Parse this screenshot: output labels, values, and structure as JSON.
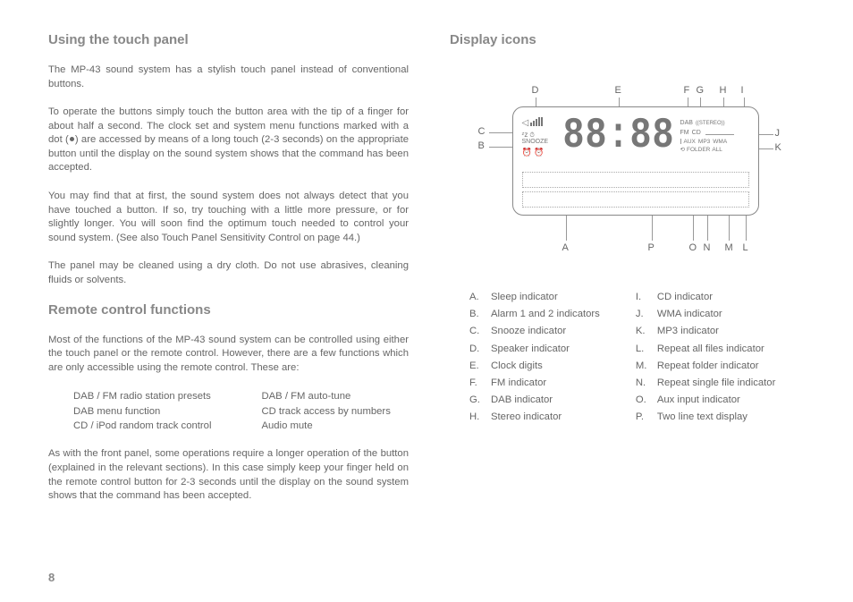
{
  "left": {
    "h1": "Using the touch panel",
    "p1": "The MP-43 sound system has a stylish touch panel instead of conventional buttons.",
    "p2a": "To operate the buttons simply touch the button area with the tip of a finger for about half a second. The clock set and system menu functions marked with a dot (",
    "p2b": ") are accessed by means of a long touch (2-3 seconds) on the appropriate button until the display on the sound system shows that the command has been accepted.",
    "p3": "You may find that at first, the sound system does not always detect that you have touched a button. If so, try touching with a little more pressure, or for slightly longer. You will soon find the optimum touch needed to control your sound system. (See also Touch Panel Sensitivity Control on page 44.)",
    "p4": "The panel may be cleaned using a dry cloth. Do not use abrasives, cleaning fluids or solvents.",
    "h2": "Remote control functions",
    "p5": "Most of the functions of the MP-43 sound system can be controlled using either the touch panel or the remote control. However, there are a few functions which are only accessible using the remote control. These are:",
    "func_l1": "DAB / FM radio station presets",
    "func_l2": "DAB menu function",
    "func_l3": "CD / iPod random track control",
    "func_r1": "DAB / FM auto-tune",
    "func_r2": "CD track access by numbers",
    "func_r3": "Audio mute",
    "p6": "As with the front panel, some operations require a longer operation of the button (explained in the relevant sections). In this case simply keep your finger held on the remote control button for 2-3 seconds until the display on the sound system shows that the command has been accepted."
  },
  "right": {
    "h1": "Display icons",
    "labels": {
      "A": "A",
      "B": "B",
      "C": "C",
      "D": "D",
      "E": "E",
      "F": "F",
      "G": "G",
      "H": "H",
      "I": "I",
      "J": "J",
      "K": "K",
      "L": "L",
      "M": "M",
      "N": "N",
      "O": "O",
      "P": "P"
    },
    "lcd": {
      "snooze": "SNOOZE",
      "clock": "88:88",
      "dab": "DAB",
      "stereo": "((STEREO))",
      "fm": "FM",
      "cd": "CD",
      "aux": "AUX",
      "mp3": "MP3",
      "wma": "WMA",
      "folder": "FOLDER",
      "all": "ALL"
    },
    "legend_left": [
      {
        "l": "A.",
        "t": "Sleep indicator"
      },
      {
        "l": "B.",
        "t": "Alarm 1 and 2 indicators"
      },
      {
        "l": "C.",
        "t": "Snooze indicator"
      },
      {
        "l": "D.",
        "t": "Speaker indicator"
      },
      {
        "l": "E.",
        "t": "Clock digits"
      },
      {
        "l": "F.",
        "t": "FM indicator"
      },
      {
        "l": "G.",
        "t": "DAB indicator"
      },
      {
        "l": "H.",
        "t": "Stereo indicator"
      }
    ],
    "legend_right": [
      {
        "l": "I.",
        "t": "CD indicator"
      },
      {
        "l": "J.",
        "t": "WMA indicator"
      },
      {
        "l": "K.",
        "t": "MP3 indicator"
      },
      {
        "l": "L.",
        "t": "Repeat all files indicator"
      },
      {
        "l": "M.",
        "t": "Repeat folder indicator"
      },
      {
        "l": "N.",
        "t": "Repeat single file indicator"
      },
      {
        "l": "O.",
        "t": "Aux input indicator"
      },
      {
        "l": "P.",
        "t": "Two line text display"
      }
    ]
  },
  "page": "8"
}
